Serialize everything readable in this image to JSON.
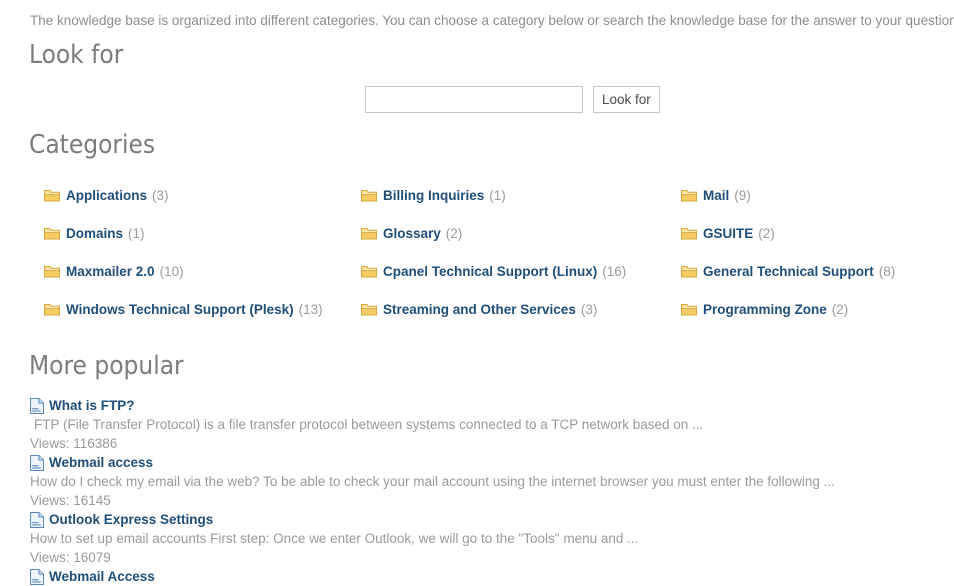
{
  "intro": {
    "text": "The knowledge base is organized into different categories. You can choose a category below or search the knowledge base for the answer to your question."
  },
  "sections": {
    "look_for_title": "Look for",
    "categories_title": "Categories",
    "popular_title": "More popular"
  },
  "search": {
    "value": "",
    "placeholder": "",
    "button_label": "Look for"
  },
  "colors": {
    "link": "#1f4e79",
    "muted": "#9a9a9a",
    "heading": "#7c7c7c",
    "folder": "#f5c842",
    "doc": "#7ea6d4"
  },
  "categories": {
    "icon": "folder-icon",
    "rows": [
      [
        {
          "label": "Applications",
          "count": "(3)"
        },
        {
          "label": "Billing Inquiries",
          "count": "(1)"
        },
        {
          "label": "Mail",
          "count": "(9)"
        }
      ],
      [
        {
          "label": "Domains",
          "count": "(1)"
        },
        {
          "label": "Glossary",
          "count": "(2)"
        },
        {
          "label": "GSUITE",
          "count": "(2)"
        }
      ],
      [
        {
          "label": "Maxmailer 2.0",
          "count": "(10)"
        },
        {
          "label": "Cpanel Technical Support (Linux)",
          "count": "(16)"
        },
        {
          "label": "General Technical Support",
          "count": "(8)"
        }
      ],
      [
        {
          "label": "Windows Technical Support (Plesk)",
          "count": "(13)"
        },
        {
          "label": "Streaming and Other Services",
          "count": "(3)"
        },
        {
          "label": "Programming Zone",
          "count": "(2)"
        }
      ]
    ]
  },
  "popular": {
    "icon": "document-icon",
    "articles": [
      {
        "title": "What is FTP?",
        "desc": "FTP (File Transfer Protocol) is a file transfer protocol between systems connected to a TCP network based on ...",
        "views": "Views: 116386"
      },
      {
        "title": "Webmail access",
        "desc": "How do I check my email via the web? To be able to check your mail account using the internet browser you must enter the following ...",
        "views": "Views: 16145"
      },
      {
        "title": "Outlook Express Settings",
        "desc": "How to set up email accounts First step: Once we enter Outlook, we will go to the \"Tools\" menu and ...",
        "views": "Views: 16079"
      },
      {
        "title": "Webmail Access",
        "desc": "",
        "views": ""
      }
    ]
  }
}
